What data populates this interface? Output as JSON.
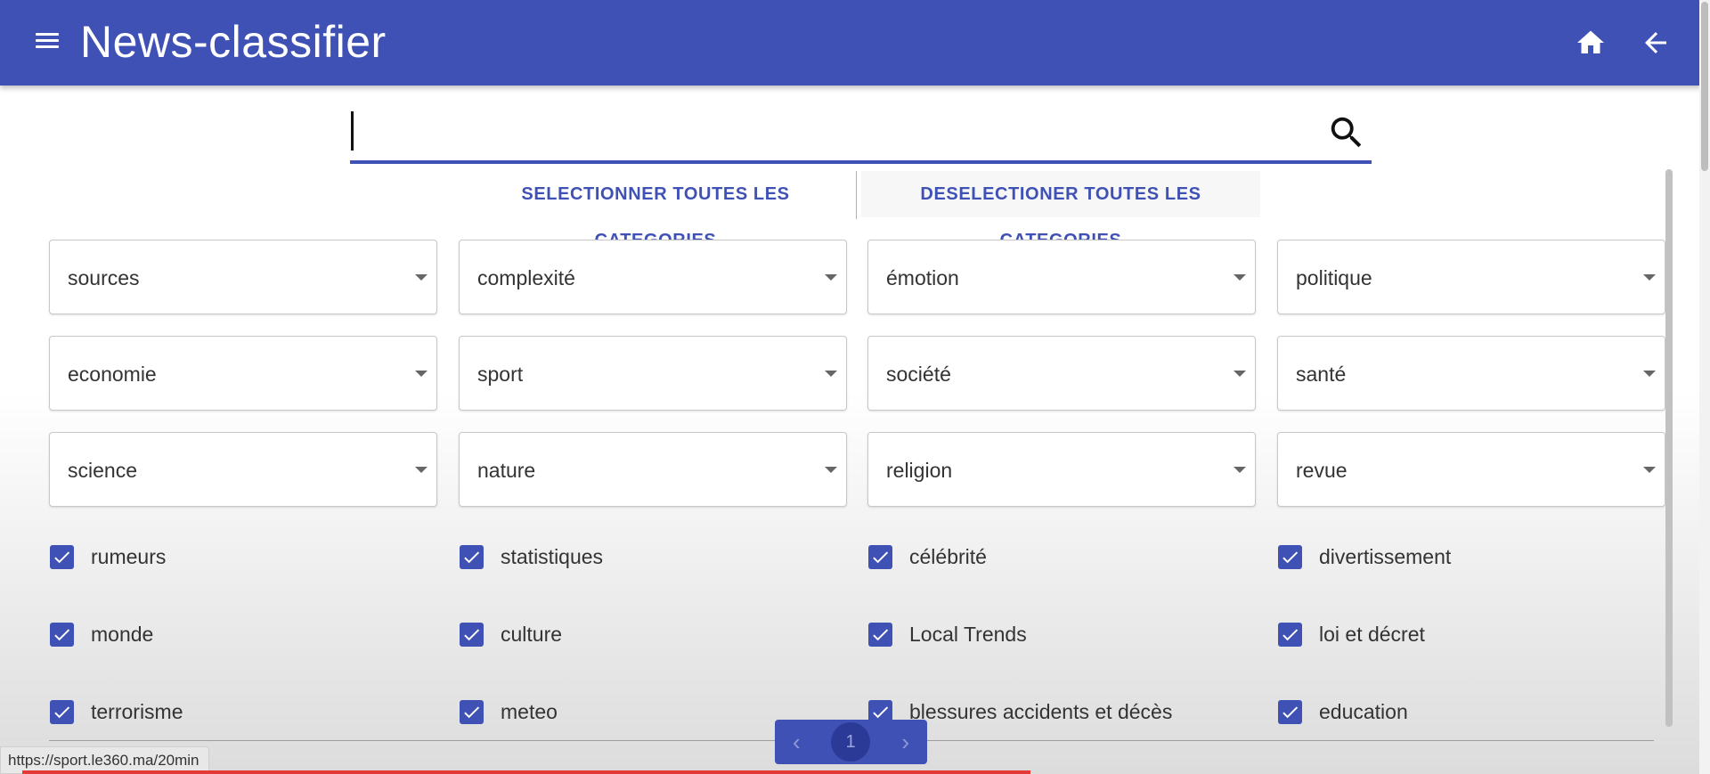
{
  "app": {
    "title": "News-classifier"
  },
  "search": {
    "value": "",
    "placeholder": ""
  },
  "actions": {
    "select_all": "SELECTIONNER TOUTES LES CATEGORIES",
    "deselect_all": "DESELECTIONER TOUTES LES CATEGORIES"
  },
  "dropdowns": [
    {
      "label": "sources"
    },
    {
      "label": "complexité"
    },
    {
      "label": "émotion"
    },
    {
      "label": "politique"
    },
    {
      "label": "economie"
    },
    {
      "label": "sport"
    },
    {
      "label": "société"
    },
    {
      "label": "santé"
    },
    {
      "label": "science"
    },
    {
      "label": "nature"
    },
    {
      "label": "religion"
    },
    {
      "label": "revue"
    }
  ],
  "checkboxes": [
    {
      "label": "rumeurs",
      "checked": true
    },
    {
      "label": "statistiques",
      "checked": true
    },
    {
      "label": "célébrité",
      "checked": true
    },
    {
      "label": "divertissement",
      "checked": true
    },
    {
      "label": "monde",
      "checked": true
    },
    {
      "label": "culture",
      "checked": true
    },
    {
      "label": "Local Trends",
      "checked": true
    },
    {
      "label": "loi et décret",
      "checked": true
    },
    {
      "label": "terrorisme",
      "checked": true
    },
    {
      "label": "meteo",
      "checked": true
    },
    {
      "label": "blessures accidents et décès",
      "checked": true
    },
    {
      "label": "education",
      "checked": true
    }
  ],
  "pagination": {
    "prev": "‹",
    "current": "1",
    "next": "›"
  },
  "status_bar": {
    "url": "https://sport.le360.ma/20min"
  },
  "colors": {
    "primary": "#3f51b5",
    "progress": "#e53935"
  },
  "icons": {
    "menu": "menu-icon",
    "home": "home-icon",
    "back": "arrow-back-icon",
    "search": "search-icon",
    "dropdown": "arrow-drop-down-icon",
    "checkbox": "check-icon"
  }
}
